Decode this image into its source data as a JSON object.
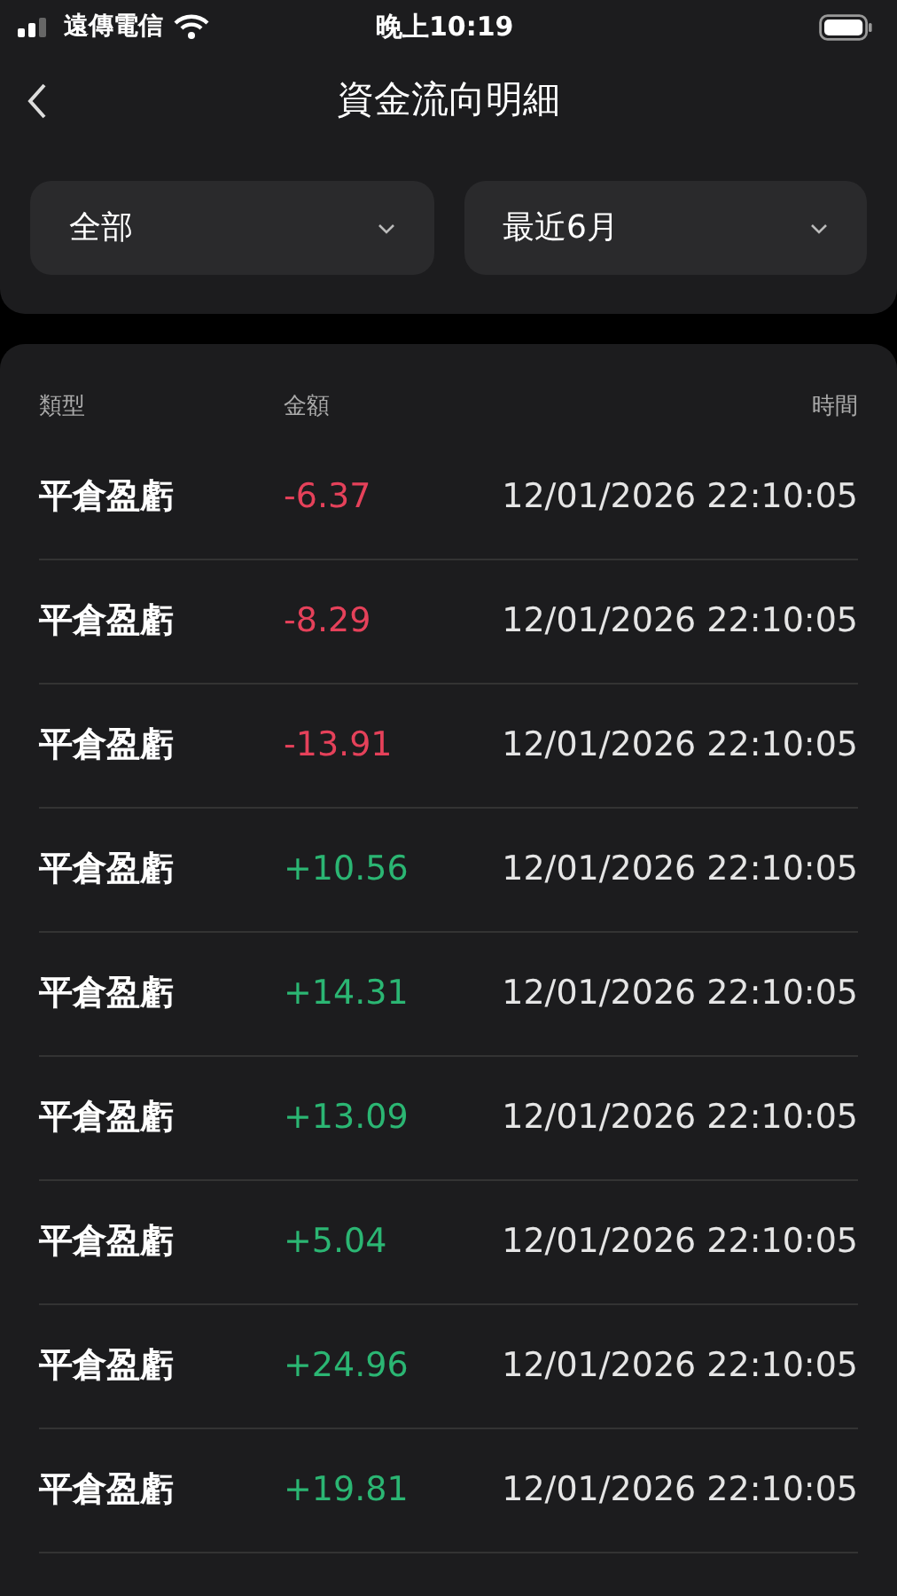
{
  "status_bar": {
    "carrier": "遠傳電信",
    "time": "晚上10:19"
  },
  "nav": {
    "title": "資金流向明細"
  },
  "filters": [
    {
      "label": "全部"
    },
    {
      "label": "最近6月"
    }
  ],
  "table": {
    "columns": [
      "類型",
      "金額",
      "時間"
    ],
    "rows": [
      {
        "type": "平倉盈虧",
        "amount": "-6.37",
        "color": "#e5415a",
        "time": "12/01/2026 22:10:05"
      },
      {
        "type": "平倉盈虧",
        "amount": "-8.29",
        "color": "#e5415a",
        "time": "12/01/2026 22:10:05"
      },
      {
        "type": "平倉盈虧",
        "amount": "-13.91",
        "color": "#e5415a",
        "time": "12/01/2026 22:10:05"
      },
      {
        "type": "平倉盈虧",
        "amount": "+10.56",
        "color": "#2bb673",
        "time": "12/01/2026 22:10:05"
      },
      {
        "type": "平倉盈虧",
        "amount": "+14.31",
        "color": "#2bb673",
        "time": "12/01/2026 22:10:05"
      },
      {
        "type": "平倉盈虧",
        "amount": "+13.09",
        "color": "#2bb673",
        "time": "12/01/2026 22:10:05"
      },
      {
        "type": "平倉盈虧",
        "amount": "+5.04",
        "color": "#2bb673",
        "time": "12/01/2026 22:10:05"
      },
      {
        "type": "平倉盈虧",
        "amount": "+24.96",
        "color": "#2bb673",
        "time": "12/01/2026 22:10:05"
      },
      {
        "type": "平倉盈虧",
        "amount": "+19.81",
        "color": "#2bb673",
        "time": "12/01/2026 22:10:05"
      }
    ]
  }
}
